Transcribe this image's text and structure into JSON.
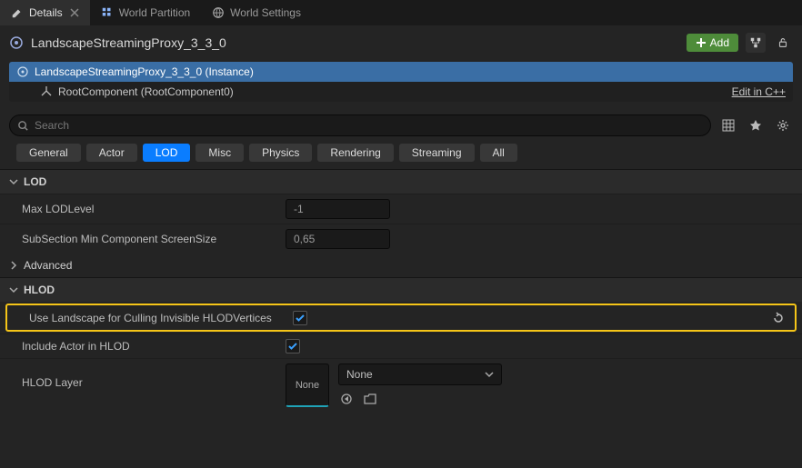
{
  "tabs": [
    {
      "label": "Details",
      "active": true
    },
    {
      "label": "World Partition",
      "active": false
    },
    {
      "label": "World Settings",
      "active": false
    }
  ],
  "header": {
    "title": "LandscapeStreamingProxy_3_3_0",
    "add_label": "Add"
  },
  "outline": {
    "row0": "LandscapeStreamingProxy_3_3_0 (Instance)",
    "row1": "RootComponent (RootComponent0)",
    "edit_link": "Edit in C++"
  },
  "search": {
    "placeholder": "Search"
  },
  "filters": {
    "general": "General",
    "actor": "Actor",
    "lod": "LOD",
    "misc": "Misc",
    "physics": "Physics",
    "rendering": "Rendering",
    "streaming": "Streaming",
    "all": "All"
  },
  "sections": {
    "lod": {
      "title": "LOD",
      "max_lod_label": "Max LODLevel",
      "max_lod_value": "-1",
      "subsection_label": "SubSection Min Component ScreenSize",
      "subsection_value": "0,65",
      "advanced_label": "Advanced"
    },
    "hlod": {
      "title": "HLOD",
      "culling_label": "Use Landscape for Culling Invisible HLODVertices",
      "include_label": "Include Actor in HLOD",
      "layer_label": "HLOD Layer",
      "layer_thumb": "None",
      "layer_value": "None"
    }
  }
}
